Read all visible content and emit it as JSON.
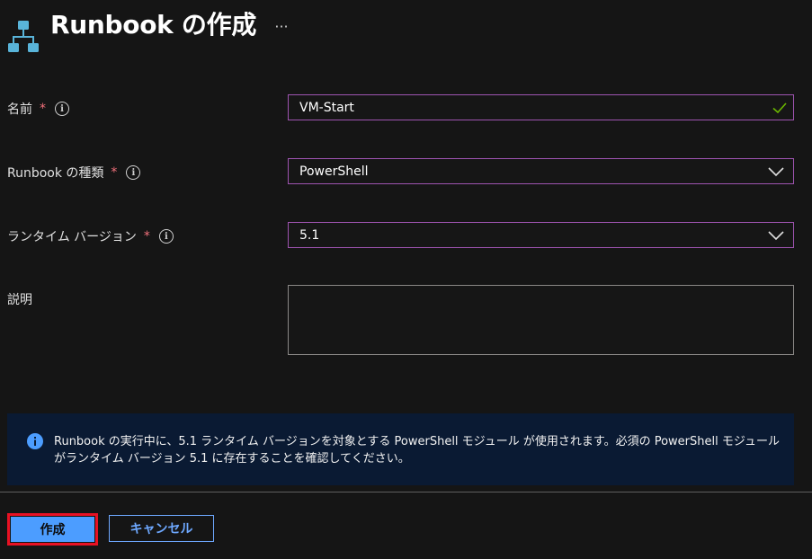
{
  "header": {
    "title": "Runbook の作成",
    "more_label": "···",
    "icon": "hierarchy-icon"
  },
  "form": {
    "name": {
      "label": "名前",
      "required_mark": "*",
      "value": "VM-Start"
    },
    "runbook_type": {
      "label": "Runbook の種類",
      "required_mark": "*",
      "value": "PowerShell"
    },
    "runtime_version": {
      "label": "ランタイム バージョン",
      "required_mark": "*",
      "value": "5.1"
    },
    "description": {
      "label": "説明",
      "value": ""
    }
  },
  "info_banner": {
    "text": "Runbook の実行中に、5.1 ランタイム バージョンを対象とする PowerShell モジュール が使用されます。必須の PowerShell モジュール がランタイム バージョン 5.1 に存在することを確認してください。"
  },
  "footer": {
    "create_label": "作成",
    "cancel_label": "キャンセル"
  },
  "colors": {
    "accent": "#4c9dff",
    "field_border": "#9e54b0",
    "required": "#f1707b",
    "valid_check": "#6bb700",
    "highlight": "#e81123"
  }
}
